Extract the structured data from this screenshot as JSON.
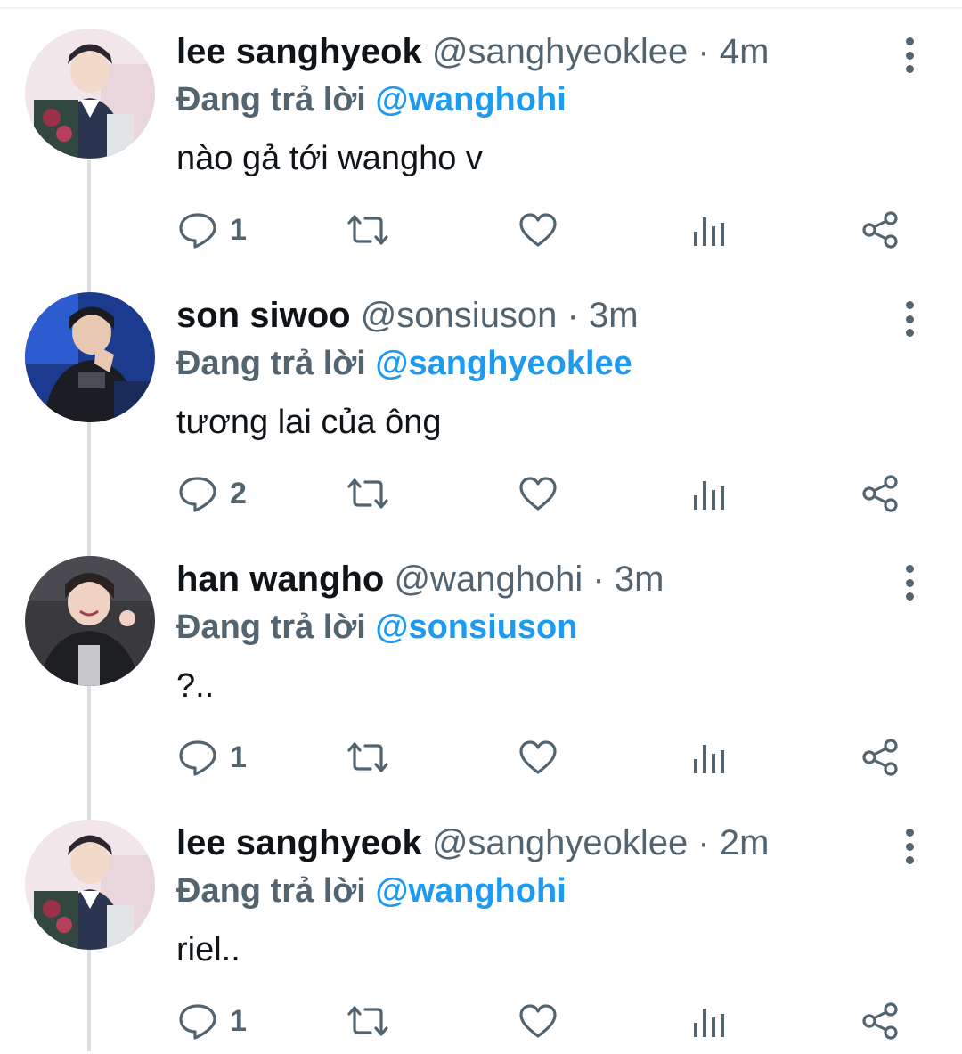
{
  "reply_prefix": "Đang trả lời",
  "tweets": [
    {
      "name": "lee sanghyeok",
      "handle": "@sanghyeoklee",
      "time": "4m",
      "reply_to": "@wanghohi",
      "text": "nào gả tới wangho v",
      "reply_count": "1",
      "avatar": "lee-sanghyeok-avatar"
    },
    {
      "name": "son siwoo",
      "handle": "@sonsiuson",
      "time": "3m",
      "reply_to": "@sanghyeoklee",
      "text": "tương lai của ông",
      "reply_count": "2",
      "avatar": "son-siwoo-avatar"
    },
    {
      "name": "han wangho",
      "handle": "@wanghohi",
      "time": "3m",
      "reply_to": "@sonsiuson",
      "text": "?..",
      "reply_count": "1",
      "avatar": "han-wangho-avatar"
    },
    {
      "name": "lee sanghyeok",
      "handle": "@sanghyeoklee",
      "time": "2m",
      "reply_to": "@wanghohi",
      "text": "riel..",
      "reply_count": "1",
      "avatar": "lee-sanghyeok-avatar"
    }
  ],
  "colors": {
    "text": "#0f1419",
    "secondary": "#536471",
    "mention": "#1d9bf0",
    "thread_line": "#d9dee2"
  },
  "icons": [
    "reply-icon",
    "retweet-icon",
    "like-icon",
    "views-icon",
    "share-icon",
    "more-icon"
  ]
}
